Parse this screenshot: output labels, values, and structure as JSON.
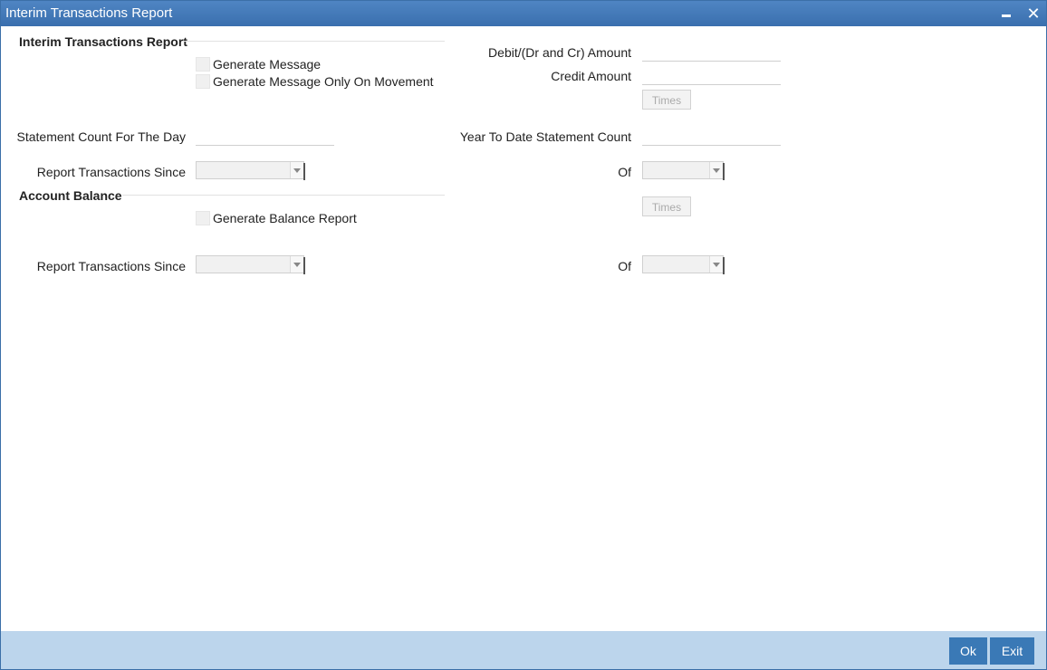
{
  "window": {
    "title": "Interim Transactions Report"
  },
  "interim": {
    "section_title": "Interim Transactions Report",
    "generate_message_label": "Generate Message",
    "generate_on_movement_label": "Generate Message Only On Movement",
    "debit_amount_label": "Debit/(Dr and Cr) Amount",
    "credit_amount_label": "Credit Amount",
    "times_label": "Times",
    "statement_count_label": "Statement Count For The Day",
    "ytd_count_label": "Year To Date Statement Count",
    "report_since_label": "Report Transactions Since",
    "of_label": "Of",
    "debit_amount_value": "",
    "credit_amount_value": "",
    "statement_count_value": "",
    "ytd_count_value": ""
  },
  "balance": {
    "section_title": "Account Balance",
    "generate_report_label": "Generate Balance Report",
    "times_label": "Times",
    "report_since_label": "Report Transactions Since",
    "of_label": "Of"
  },
  "footer": {
    "ok_label": "Ok",
    "exit_label": "Exit"
  },
  "icons": {
    "minimize": "minimize-icon",
    "close": "close-icon",
    "dropdown": "chevron-down-icon"
  },
  "colors": {
    "titlebar": "#3f77b8",
    "footer": "#bcd5ec",
    "button": "#3a79b6"
  }
}
